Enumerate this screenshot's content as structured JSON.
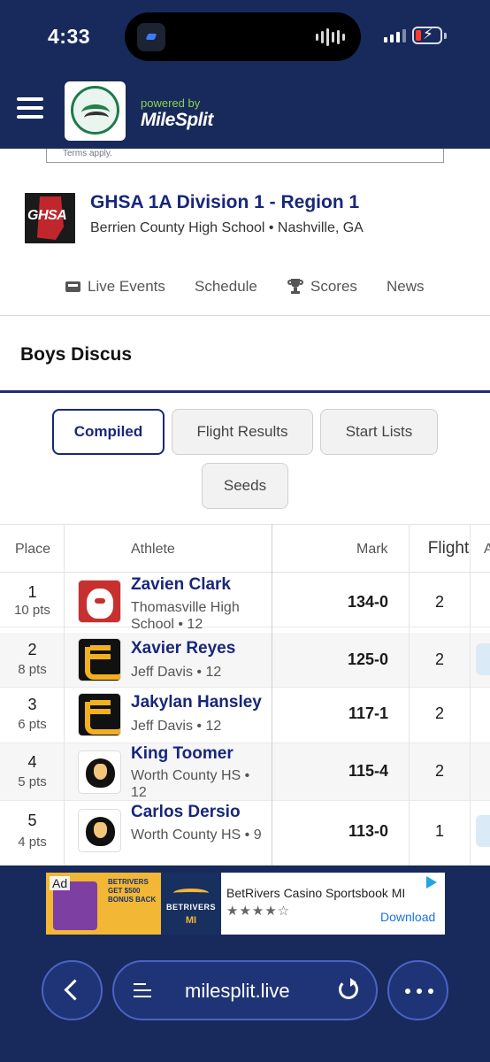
{
  "status_bar": {
    "time": "4:33"
  },
  "header": {
    "powered_by": "powered by",
    "brand": "MileSplit"
  },
  "ad_top": {
    "text": "Terms apply."
  },
  "meet": {
    "logo_text": "GHSA",
    "title": "GHSA 1A Division 1 - Region 1",
    "subtitle": "Berrien County High School • Nashville, GA"
  },
  "nav": {
    "live_events": "Live Events",
    "schedule": "Schedule",
    "scores": "Scores",
    "news": "News"
  },
  "event": {
    "title": "Boys Discus"
  },
  "views": {
    "compiled": "Compiled",
    "flight_results": "Flight Results",
    "start_lists": "Start Lists",
    "seeds": "Seeds",
    "active": "Compiled"
  },
  "table": {
    "headers": {
      "place": "Place",
      "athlete": "Athlete",
      "mark": "Mark",
      "flight": "Flight",
      "extra": "A"
    },
    "rows": [
      {
        "place": "1",
        "points": "10 pts",
        "name": "Zavien Clark",
        "school": "Thomasville High School • 12",
        "mark": "134-0",
        "flight": "2",
        "logo": "bulldog-logo"
      },
      {
        "place": "2",
        "points": "8 pts",
        "name": "Xavier Reyes",
        "school": "Jeff Davis • 12",
        "mark": "125-0",
        "flight": "2",
        "logo": "jd-logo"
      },
      {
        "place": "3",
        "points": "6 pts",
        "name": "Jakylan Hansley",
        "school": "Jeff Davis • 12",
        "mark": "117-1",
        "flight": "2",
        "logo": "jd-logo"
      },
      {
        "place": "4",
        "points": "5 pts",
        "name": "King Toomer",
        "school": "Worth County HS • 12",
        "mark": "115-4",
        "flight": "2",
        "logo": "ram-logo"
      },
      {
        "place": "5",
        "points": "4 pts",
        "name": "Carlos Dersio",
        "school": "Worth County HS • 9",
        "mark": "113-0",
        "flight": "1",
        "logo": "ram-logo"
      }
    ]
  },
  "ad_bottom": {
    "label": "Ad",
    "image_text": "BETRIVERS GET $500 BONUS BACK",
    "brand": "BETRIVERS",
    "brand_region": "MI",
    "title": "BetRivers Casino Sportsbook MI",
    "stars": "★★★★☆",
    "cta": "Download"
  },
  "browser": {
    "url": "milesplit.live"
  },
  "colors": {
    "navy": "#182a5c",
    "link": "#18277a",
    "accent": "#1d2d70"
  }
}
